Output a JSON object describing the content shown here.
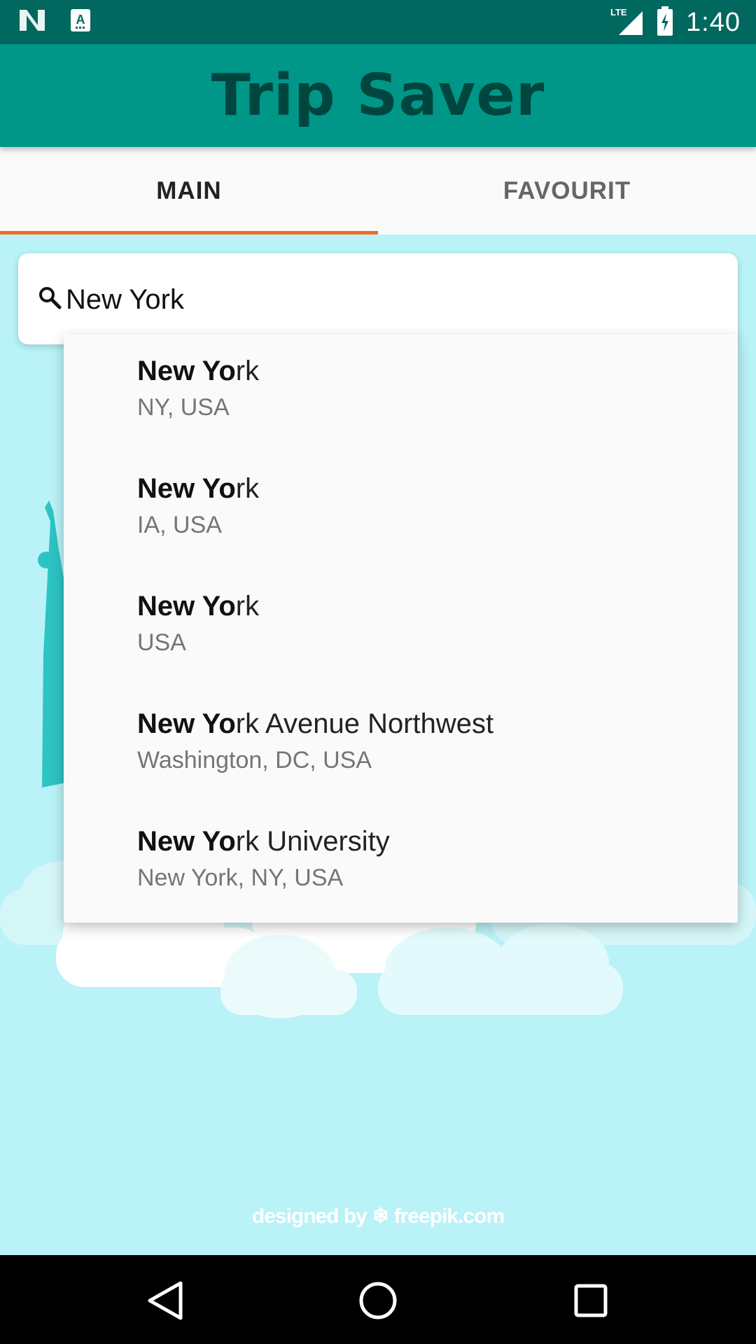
{
  "status_bar": {
    "left_icons": [
      "n-logo-icon",
      "app-notification-icon"
    ],
    "network_label": "LTE",
    "time": "1:40"
  },
  "app": {
    "title": "Trip Saver"
  },
  "tabs": [
    {
      "label": "MAIN",
      "active": true
    },
    {
      "label": "FAVOURIT",
      "active": false
    }
  ],
  "search": {
    "value": "New York",
    "icon": "search-icon"
  },
  "suggestions": [
    {
      "bold": "New Yo",
      "rest": "rk",
      "sub": "NY, USA"
    },
    {
      "bold": "New Yo",
      "rest": "rk",
      "sub": "IA, USA"
    },
    {
      "bold": "New Yo",
      "rest": "rk",
      "sub": "USA"
    },
    {
      "bold": "New Yo",
      "rest": "rk Avenue Northwest",
      "sub": "Washington, DC, USA"
    },
    {
      "bold": "New Yo",
      "rest": "rk University",
      "sub": "New York, NY, USA"
    }
  ],
  "background": {
    "credit": "designed by ❄ freepik.com"
  },
  "nav": [
    "back-icon",
    "home-icon",
    "recents-icon"
  ],
  "colors": {
    "status_bar": "#00685f",
    "app_bar": "#009688",
    "title": "#00463f",
    "tab_indicator": "#f26b23",
    "content_bg": "#b9f2f7"
  }
}
